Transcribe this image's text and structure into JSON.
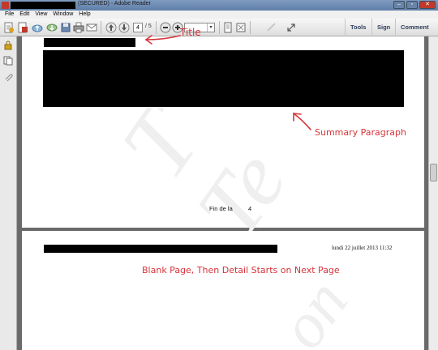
{
  "window": {
    "title": "(SECURED) - Adobe Reader"
  },
  "menu": {
    "items": [
      {
        "label": "File"
      },
      {
        "label": "Edit"
      },
      {
        "label": "View"
      },
      {
        "label": "Window"
      },
      {
        "label": "Help"
      }
    ]
  },
  "toolbar": {
    "page_number": "4",
    "page_total": "/ 5",
    "zoom_arrow": "▾",
    "tools_label": "Tools",
    "sign_label": "Sign",
    "comment_label": "Comment"
  },
  "document": {
    "page1": {
      "footer_text": "Fin de la",
      "footer_number": "4"
    },
    "page2": {
      "date_text": "lundi 22 juillet 2013  11:32"
    }
  },
  "annotations": {
    "title": "Title",
    "summary": "Summary Paragraph",
    "blank_page": "Blank Page, Then Detail Starts on Next Page",
    "color": "#d6343a"
  },
  "icons": {
    "toolbar": [
      "create-pdf-icon",
      "edit-icon",
      "upload-cloud-icon",
      "download-cloud-icon",
      "save-icon",
      "print-icon",
      "email-icon",
      "prev-page-icon",
      "next-page-icon",
      "zoom-out-icon",
      "zoom-in-icon",
      "fit-page-icon",
      "full-screen-icon",
      "read-mode-icon",
      "expand-icon"
    ],
    "nav": [
      "lock-icon",
      "pages-icon",
      "attachment-icon"
    ]
  }
}
